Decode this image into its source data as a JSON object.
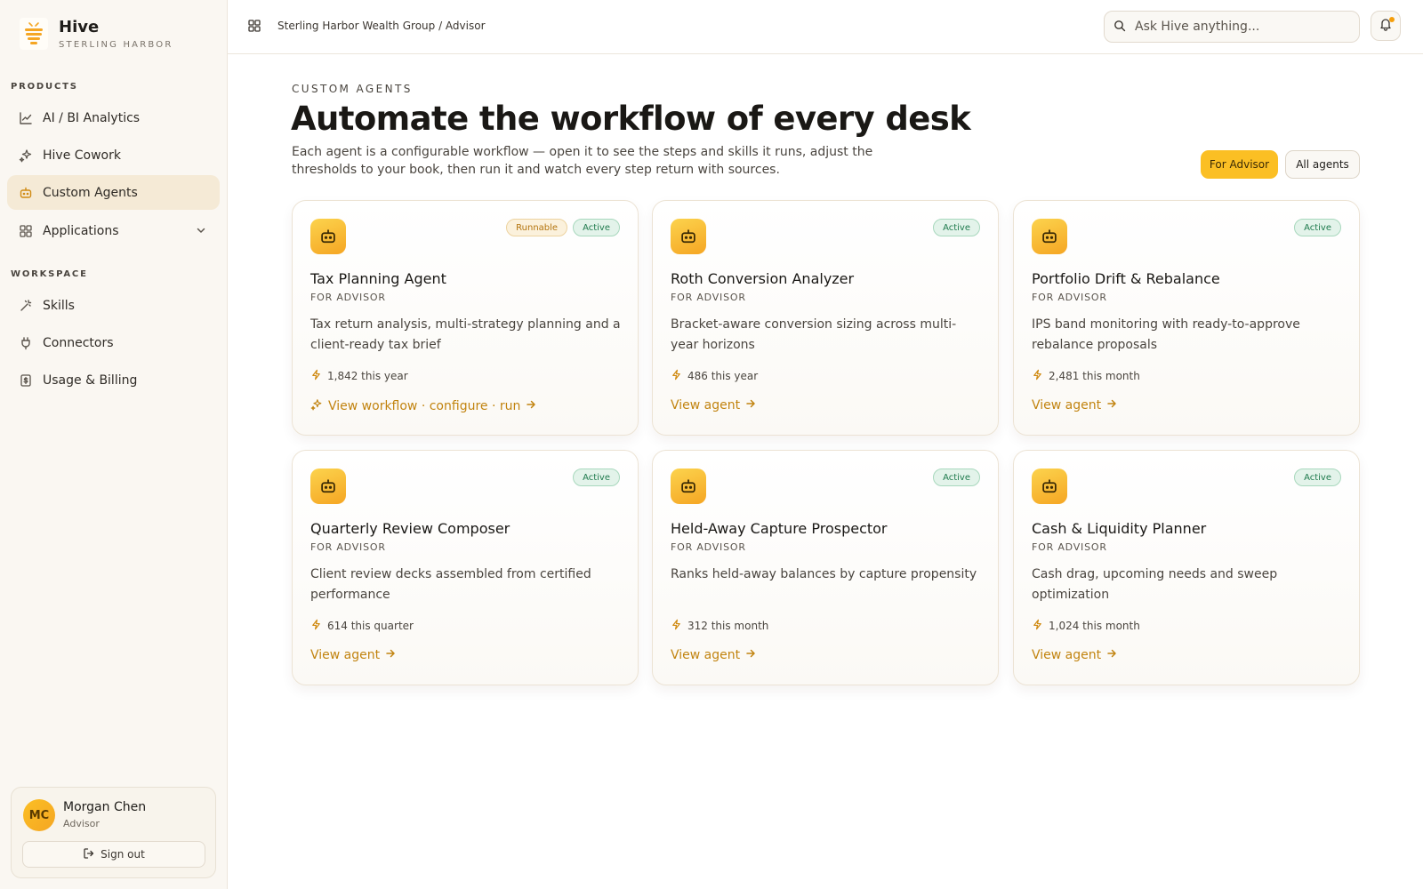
{
  "brand": {
    "name": "Hive",
    "sub": "STERLING HARBOR"
  },
  "sidebar": {
    "products_label": "PRODUCTS",
    "workspace_label": "WORKSPACE",
    "products": [
      {
        "label": "AI / BI Analytics",
        "icon": "line-chart-icon"
      },
      {
        "label": "Hive Cowork",
        "icon": "sparkles-icon"
      },
      {
        "label": "Custom Agents",
        "icon": "bot-icon",
        "active": true
      },
      {
        "label": "Applications",
        "icon": "grid-icon"
      }
    ],
    "workspace": [
      {
        "label": "Skills",
        "icon": "wand-icon"
      },
      {
        "label": "Connectors",
        "icon": "plug-icon"
      },
      {
        "label": "Usage & Billing",
        "icon": "receipt-icon"
      }
    ]
  },
  "user": {
    "initials": "MC",
    "name": "Morgan Chen",
    "role": "Advisor",
    "signout": "Sign out"
  },
  "header": {
    "breadcrumb": "Sterling Harbor Wealth Group / Advisor",
    "search_placeholder": "Ask Hive anything..."
  },
  "main": {
    "eyebrow": "CUSTOM AGENTS",
    "title": "Automate the workflow of every desk",
    "subtitle": "Each agent is a configurable workflow — open it to see the steps and skills it runs, adjust the thresholds to your book, then run it and watch every step return with sources.",
    "filters": {
      "primary": "For Advisor",
      "secondary": "All agents"
    }
  },
  "cards": [
    {
      "title": "Tax Planning Agent",
      "audience": "FOR ADVISOR",
      "desc": "Tax return analysis, multi-strategy planning and a client-ready tax brief",
      "stat": "1,842 this year",
      "link": "View workflow · configure · run",
      "runnable": "Runnable",
      "status": "Active"
    },
    {
      "title": "Roth Conversion Analyzer",
      "audience": "FOR ADVISOR",
      "desc": "Bracket-aware conversion sizing across multi-year horizons",
      "stat": "486 this year",
      "link": "View agent",
      "status": "Active"
    },
    {
      "title": "Portfolio Drift & Rebalance",
      "audience": "FOR ADVISOR",
      "desc": "IPS band monitoring with ready-to-approve rebalance proposals",
      "stat": "2,481 this month",
      "link": "View agent",
      "status": "Active"
    },
    {
      "title": "Quarterly Review Composer",
      "audience": "FOR ADVISOR",
      "desc": "Client review decks assembled from certified performance",
      "stat": "614 this quarter",
      "link": "View agent",
      "status": "Active"
    },
    {
      "title": "Held-Away Capture Prospector",
      "audience": "FOR ADVISOR",
      "desc": "Ranks held-away balances by capture propensity",
      "stat": "312 this month",
      "link": "View agent",
      "status": "Active"
    },
    {
      "title": "Cash & Liquidity Planner",
      "audience": "FOR ADVISOR",
      "desc": "Cash drag, upcoming needs and sweep optimization",
      "stat": "1,024 this month",
      "link": "View agent",
      "status": "Active"
    }
  ]
}
